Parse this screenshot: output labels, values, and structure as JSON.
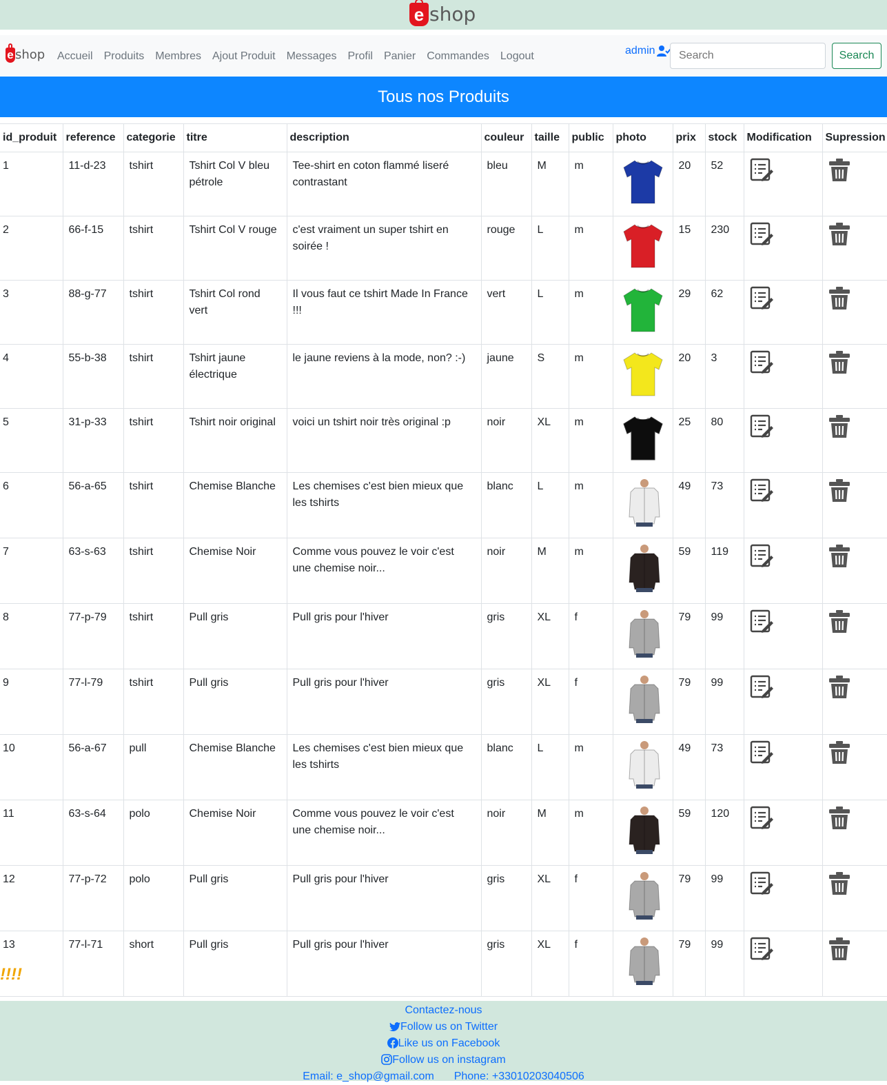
{
  "brand": {
    "logo_letter": "e",
    "logo_word": "shop",
    "logo_color": "#e3151e"
  },
  "nav": {
    "links": [
      "Accueil",
      "Produits",
      "Membres",
      "Ajout Produit",
      "Messages",
      "Profil",
      "Panier",
      "Commandes",
      "Logout"
    ],
    "user": "admin",
    "search_placeholder": "Search",
    "search_button": "Search"
  },
  "page": {
    "title": "Tous nos Produits"
  },
  "table": {
    "headers": [
      "id_produit",
      "reference",
      "categorie",
      "titre",
      "description",
      "couleur",
      "taille",
      "public",
      "photo",
      "prix",
      "stock",
      "Modification",
      "Supression"
    ],
    "rows": [
      {
        "id": "1",
        "reference": "11-d-23",
        "categorie": "tshirt",
        "titre": "Tshirt Col V bleu pétrole",
        "description": "Tee-shirt en coton flammé liseré contrastant",
        "couleur": "bleu",
        "taille": "M",
        "public": "m",
        "prix": "20",
        "stock": "52",
        "photo": "tshirt",
        "photo_color": "#1c3aa6"
      },
      {
        "id": "2",
        "reference": "66-f-15",
        "categorie": "tshirt",
        "titre": "Tshirt Col V rouge",
        "description": "c'est vraiment un super tshirt en soirée !",
        "couleur": "rouge",
        "taille": "L",
        "public": "m",
        "prix": "15",
        "stock": "230",
        "photo": "tshirt",
        "photo_color": "#d91f26"
      },
      {
        "id": "3",
        "reference": "88-g-77",
        "categorie": "tshirt",
        "titre": "Tshirt Col rond vert",
        "description": "Il vous faut ce tshirt Made In France !!!",
        "couleur": "vert",
        "taille": "L",
        "public": "m",
        "prix": "29",
        "stock": "62",
        "photo": "tshirt",
        "photo_color": "#22b43a"
      },
      {
        "id": "4",
        "reference": "55-b-38",
        "categorie": "tshirt",
        "titre": "Tshirt jaune électrique",
        "description": "le jaune reviens à la mode, non? :-)",
        "couleur": "jaune",
        "taille": "S",
        "public": "m",
        "prix": "20",
        "stock": "3",
        "photo": "tshirt",
        "photo_color": "#f3e71c"
      },
      {
        "id": "5",
        "reference": "31-p-33",
        "categorie": "tshirt",
        "titre": "Tshirt noir original",
        "description": "voici un tshirt noir très original :p",
        "couleur": "noir",
        "taille": "XL",
        "public": "m",
        "prix": "25",
        "stock": "80",
        "photo": "tshirt",
        "photo_color": "#0d0d0d"
      },
      {
        "id": "6",
        "reference": "56-a-65",
        "categorie": "tshirt",
        "titre": "Chemise Blanche",
        "description": "Les chemises c'est bien mieux que les tshirts",
        "couleur": "blanc",
        "taille": "L",
        "public": "m",
        "prix": "49",
        "stock": "73",
        "photo": "shirt",
        "photo_color": "#ececec"
      },
      {
        "id": "7",
        "reference": "63-s-63",
        "categorie": "tshirt",
        "titre": "Chemise Noir",
        "description": "Comme vous pouvez le voir c'est une chemise noir...",
        "couleur": "noir",
        "taille": "M",
        "public": "m",
        "prix": "59",
        "stock": "119",
        "photo": "shirt",
        "photo_color": "#2a2220"
      },
      {
        "id": "8",
        "reference": "77-p-79",
        "categorie": "tshirt",
        "titre": "Pull gris",
        "description": "Pull gris pour l'hiver",
        "couleur": "gris",
        "taille": "XL",
        "public": "f",
        "prix": "79",
        "stock": "99",
        "photo": "shirt",
        "photo_color": "#a9a9a9"
      },
      {
        "id": "9",
        "reference": "77-l-79",
        "categorie": "tshirt",
        "titre": "Pull gris",
        "description": "Pull gris pour l'hiver",
        "couleur": "gris",
        "taille": "XL",
        "public": "f",
        "prix": "79",
        "stock": "99",
        "photo": "shirt",
        "photo_color": "#a9a9a9"
      },
      {
        "id": "10",
        "reference": "56-a-67",
        "categorie": "pull",
        "titre": "Chemise Blanche",
        "description": "Les chemises c'est bien mieux que les tshirts",
        "couleur": "blanc",
        "taille": "L",
        "public": "m",
        "prix": "49",
        "stock": "73",
        "photo": "shirt",
        "photo_color": "#ececec"
      },
      {
        "id": "11",
        "reference": "63-s-64",
        "categorie": "polo",
        "titre": "Chemise Noir",
        "description": "Comme vous pouvez le voir c'est une chemise noir...",
        "couleur": "noir",
        "taille": "M",
        "public": "m",
        "prix": "59",
        "stock": "120",
        "photo": "shirt",
        "photo_color": "#2a2220"
      },
      {
        "id": "12",
        "reference": "77-p-72",
        "categorie": "polo",
        "titre": "Pull gris",
        "description": "Pull gris pour l'hiver",
        "couleur": "gris",
        "taille": "XL",
        "public": "f",
        "prix": "79",
        "stock": "99",
        "photo": "shirt",
        "photo_color": "#a9a9a9"
      },
      {
        "id": "13",
        "reference": "77-l-71",
        "categorie": "short",
        "titre": "Pull gris",
        "description": "Pull gris pour l'hiver",
        "couleur": "gris",
        "taille": "XL",
        "public": "f",
        "prix": "79",
        "stock": "99",
        "photo": "shirt",
        "photo_color": "#a9a9a9"
      }
    ]
  },
  "alert_text": "!!!!",
  "footer": {
    "contact": "Contactez-nous",
    "twitter": "Follow us on Twitter",
    "facebook": "Like us on Facebook",
    "instagram": "Follow us on instagram",
    "email": "Email: e_shop@gmail.com",
    "phone": "Phone: +33010203040506"
  },
  "colors": {
    "topbar": "#d1e7dd",
    "title_bar": "#0d86ff",
    "link": "#0d6efd",
    "search_button": "#198754",
    "alert": "#f0a500"
  }
}
